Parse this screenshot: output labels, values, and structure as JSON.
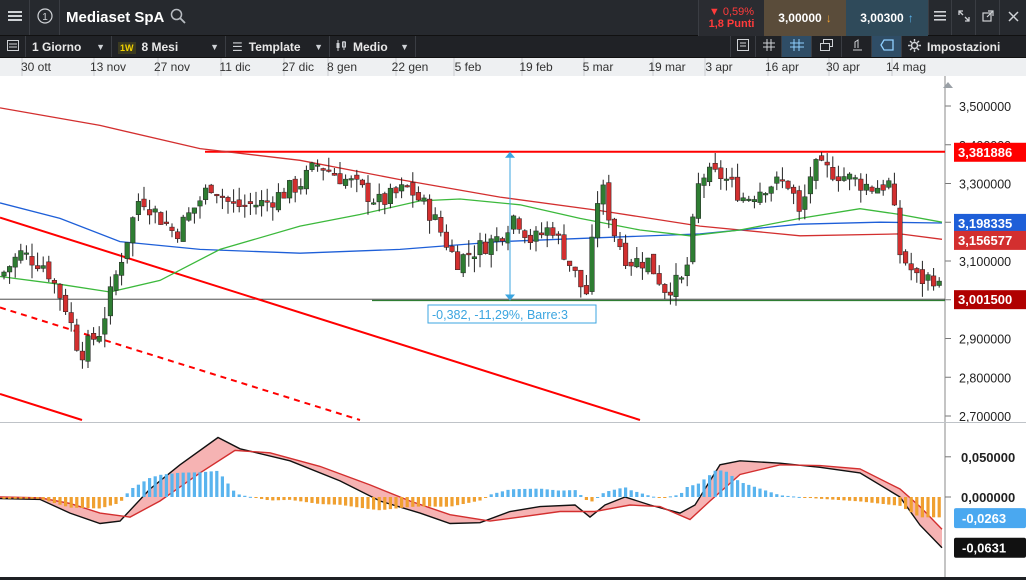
{
  "header": {
    "symbol": "Mediaset SpA",
    "change_pct": "▼ 0,59%",
    "change_pts": "1,8 Punti",
    "sell_price": "3,00000",
    "buy_price": "3,00300"
  },
  "toolbar": {
    "interval": "1 Giorno",
    "range_badge": "1W",
    "range": "8 Mesi",
    "template": "Template",
    "chart_style": "Medio",
    "settings": "Impostazioni"
  },
  "colors": {
    "candle_up": "#2e7d32",
    "candle_down": "#d32f2f",
    "ma_red": "#d32f2f",
    "ma_blue": "#1e5fd8",
    "ma_green": "#3cb93c",
    "resistance_line": "#ff0000",
    "histogram_pos": "#5ab4ee",
    "histogram_neg": "#f0a030"
  },
  "chart_data": {
    "type": "candlestick",
    "x_ticks": [
      "30 ott",
      "13 nov",
      "27 nov",
      "11 dic",
      "27 dic",
      "8 gen",
      "22 gen",
      "5 feb",
      "19 feb",
      "5 mar",
      "19 mar",
      "3 apr",
      "16 apr",
      "30 apr",
      "14 mag"
    ],
    "y_ticks": [
      "3,500000",
      "3,400000",
      "3,300000",
      "3,200000",
      "3,100000",
      "3,000000",
      "2,900000",
      "2,800000",
      "2,700000"
    ],
    "ylim": [
      2.69,
      3.555
    ],
    "price_labels": [
      {
        "text": "3,381886",
        "value": 3.381886,
        "color": "#ff0000"
      },
      {
        "text": "3,198335",
        "value": 3.198335,
        "color": "#1e5fd8"
      },
      {
        "text": "3,156577",
        "value": 3.156577,
        "color": "#d32f2f"
      },
      {
        "text": "3,001500",
        "value": 3.0015,
        "color": "#b00000"
      }
    ],
    "measure_label": "-0,382, -11,29%, Barre:3",
    "indicator": {
      "y_ticks": [
        "0,050000",
        "0,000000"
      ],
      "ylim": [
        -0.072,
        0.082
      ],
      "labels": [
        {
          "text": "-0,0263",
          "value": -0.0263,
          "color": "#4aa8f0"
        },
        {
          "text": "-0,0631",
          "value": -0.0631,
          "color": "#111111"
        }
      ]
    }
  }
}
